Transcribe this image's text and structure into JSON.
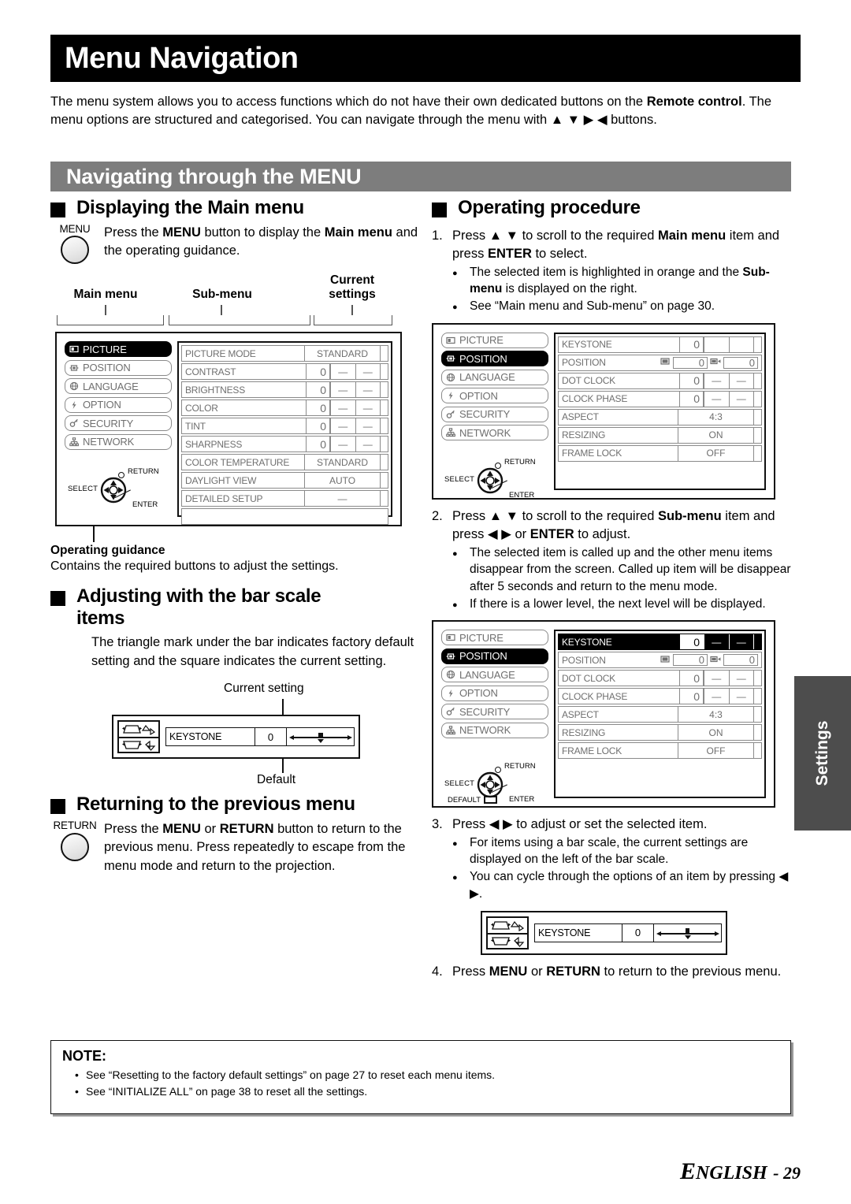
{
  "header": {
    "title": "Menu Navigation",
    "intro_parts": [
      {
        "t": "The menu system allows you to access functions which do not have their own dedicated buttons on the ",
        "b": false
      },
      {
        "t": "Remote control",
        "b": true
      },
      {
        "t": ". The menu options are structured and categorised. You can navigate through the menu with ▲ ▼ ▶ ◀ buttons.",
        "b": false
      }
    ],
    "banner": "Navigating through the MENU"
  },
  "left": {
    "displaying": {
      "heading": "Displaying the Main menu",
      "button_label": "MENU",
      "text_parts": [
        {
          "t": "Press the ",
          "b": false
        },
        {
          "t": "MENU",
          "b": true
        },
        {
          "t": " button to display the ",
          "b": false
        },
        {
          "t": "Main menu",
          "b": true
        },
        {
          "t": " and the operating guidance.",
          "b": false
        }
      ]
    },
    "callouts": {
      "main_menu": "Main menu",
      "sub_menu": "Sub-menu",
      "current_settings_l1": "Current",
      "current_settings_l2": "settings"
    },
    "guidance": {
      "title": "Operating guidance",
      "text": "Contains the required buttons to adjust the settings."
    },
    "barscale": {
      "heading_l1": "Adjusting with the bar scale",
      "heading_l2": "items",
      "text": "The triangle mark under the bar indicates factory default setting and the square indicates the current setting.",
      "current_setting_label": "Current setting",
      "default_label": "Default",
      "widget": {
        "name": "KEYSTONE",
        "value": "0"
      }
    },
    "returning": {
      "heading": "Returning to the previous menu",
      "button_label": "RETURN",
      "text_parts": [
        {
          "t": "Press the ",
          "b": false
        },
        {
          "t": "MENU",
          "b": true
        },
        {
          "t": " or ",
          "b": false
        },
        {
          "t": "RETURN",
          "b": true
        },
        {
          "t": " button to return to the previous menu. Press repeatedly to escape from the menu mode and return to the projection.",
          "b": false
        }
      ]
    }
  },
  "right": {
    "heading": "Operating procedure",
    "steps": [
      {
        "n": "1.",
        "parts": [
          {
            "t": "Press ▲ ▼ to scroll to the required ",
            "b": false
          },
          {
            "t": "Main menu",
            "b": true
          },
          {
            "t": " item and press ",
            "b": false
          },
          {
            "t": "ENTER",
            "b": true
          },
          {
            "t": " to select.",
            "b": false
          }
        ],
        "bullets": [
          [
            {
              "t": "The selected item is highlighted in orange and the ",
              "b": false
            },
            {
              "t": "Sub-menu",
              "b": true
            },
            {
              "t": " is displayed on the right.",
              "b": false
            }
          ],
          [
            {
              "t": "See “Main menu and Sub-menu” on page 30.",
              "b": false
            }
          ]
        ]
      },
      {
        "n": "2.",
        "parts": [
          {
            "t": "Press ▲ ▼ to scroll to the required ",
            "b": false
          },
          {
            "t": "Sub-menu",
            "b": true
          },
          {
            "t": " item and press ◀ ▶ or ",
            "b": false
          },
          {
            "t": "ENTER",
            "b": true
          },
          {
            "t": " to adjust.",
            "b": false
          }
        ],
        "bullets": [
          [
            {
              "t": "The selected item is called up and the other menu items disappear from the screen. Called up item will be disappear after 5 seconds and return to the menu mode.",
              "b": false
            }
          ],
          [
            {
              "t": "If there is a lower level, the next level will be displayed.",
              "b": false
            }
          ]
        ]
      },
      {
        "n": "3.",
        "parts": [
          {
            "t": "Press ◀ ▶ to adjust or set the selected item.",
            "b": false
          }
        ],
        "bullets": [
          [
            {
              "t": "For items using a bar scale, the current settings are displayed on the left of the bar scale.",
              "b": false
            }
          ],
          [
            {
              "t": "You can cycle through the options of an item by pressing ◀ ▶.",
              "b": false
            }
          ]
        ]
      },
      {
        "n": "4.",
        "parts": [
          {
            "t": "Press ",
            "b": false
          },
          {
            "t": "MENU",
            "b": true
          },
          {
            "t": " or ",
            "b": false
          },
          {
            "t": "RETURN",
            "b": true
          },
          {
            "t": " to return to the previous menu.",
            "b": false
          }
        ],
        "bullets": []
      }
    ],
    "keystone_widget": {
      "name": "KEYSTONE",
      "value": "0"
    }
  },
  "osd": {
    "main_menu_items": [
      {
        "label": "PICTURE",
        "icon": "picture-icon"
      },
      {
        "label": "POSITION",
        "icon": "position-icon"
      },
      {
        "label": "LANGUAGE",
        "icon": "globe-icon"
      },
      {
        "label": "OPTION",
        "icon": "plug-icon"
      },
      {
        "label": "SECURITY",
        "icon": "key-icon"
      },
      {
        "label": "NETWORK",
        "icon": "network-icon"
      }
    ],
    "nav": {
      "select": "SELECT",
      "return": "RETURN",
      "enter": "ENTER",
      "default": "DEFAULT"
    },
    "picture_submenu": [
      {
        "name": "PICTURE MODE",
        "kind": "wide",
        "value": "STANDARD"
      },
      {
        "name": "CONTRAST",
        "kind": "bar",
        "value": "0",
        "dash": "—"
      },
      {
        "name": "BRIGHTNESS",
        "kind": "bar",
        "value": "0",
        "dash": "—"
      },
      {
        "name": "COLOR",
        "kind": "bar",
        "value": "0",
        "dash": "—"
      },
      {
        "name": "TINT",
        "kind": "bar",
        "value": "0",
        "dash": "—"
      },
      {
        "name": "SHARPNESS",
        "kind": "bar",
        "value": "0",
        "dash": "—"
      },
      {
        "name": "COLOR TEMPERATURE",
        "kind": "wide",
        "value": "STANDARD"
      },
      {
        "name": "DAYLIGHT VIEW",
        "kind": "wide",
        "value": "AUTO"
      },
      {
        "name": "DETAILED SETUP",
        "kind": "wide",
        "value": "—"
      }
    ],
    "position_submenu": [
      {
        "name": "KEYSTONE",
        "kind": "bar",
        "value": "0",
        "dash": ""
      },
      {
        "name": "POSITION",
        "kind": "position",
        "value_h": "0",
        "value_v": "0"
      },
      {
        "name": "DOT CLOCK",
        "kind": "bar",
        "value": "0",
        "dash": "—"
      },
      {
        "name": "CLOCK PHASE",
        "kind": "bar",
        "value": "0",
        "dash": "—"
      },
      {
        "name": "ASPECT",
        "kind": "wide",
        "value": "4:3"
      },
      {
        "name": "RESIZING",
        "kind": "wide",
        "value": "ON"
      },
      {
        "name": "FRAME LOCK",
        "kind": "wide",
        "value": "OFF"
      }
    ],
    "position_submenu_hl": [
      {
        "name": "KEYSTONE",
        "kind": "bar",
        "value": "0",
        "dash": "—"
      },
      {
        "name": "POSITION",
        "kind": "position",
        "value_h": "0",
        "value_v": "0"
      },
      {
        "name": "DOT CLOCK",
        "kind": "bar",
        "value": "0",
        "dash": "—"
      },
      {
        "name": "CLOCK PHASE",
        "kind": "bar",
        "value": "0",
        "dash": "—"
      },
      {
        "name": "ASPECT",
        "kind": "wide",
        "value": "4:3"
      },
      {
        "name": "RESIZING",
        "kind": "wide",
        "value": "ON"
      },
      {
        "name": "FRAME LOCK",
        "kind": "wide",
        "value": "OFF"
      }
    ]
  },
  "note": {
    "title": "NOTE:",
    "items": [
      "See “Resetting to the factory default settings” on page 27 to reset each menu items.",
      "See “INITIALIZE ALL” on page 38 to reset all the settings."
    ]
  },
  "side_tab": "Settings",
  "footer": {
    "lang": "ENGLISH",
    "page": "- 29"
  },
  "colors": {
    "banner": "#7d7d7d",
    "title_bar": "#000000",
    "side_tab": "#4d4d4d",
    "menu_gray": "#6f6f6f"
  }
}
